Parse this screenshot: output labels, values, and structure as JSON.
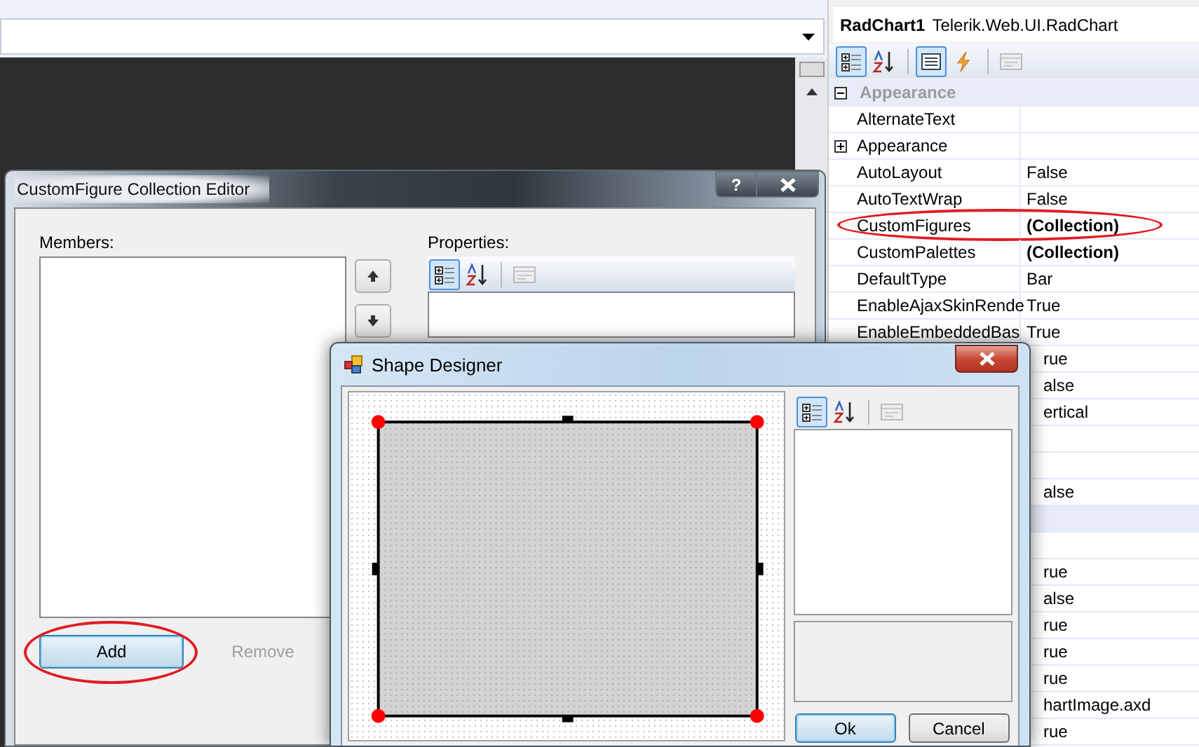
{
  "properties_panel": {
    "object_name": "RadChart1",
    "object_type": "Telerik.Web.UI.RadChart",
    "toolbar": [
      {
        "kind": "categorized",
        "selected": true,
        "disabled": false
      },
      {
        "kind": "alphabetical",
        "selected": false,
        "disabled": false
      },
      {
        "kind": "properties",
        "selected": true,
        "disabled": false
      },
      {
        "kind": "events",
        "selected": false,
        "disabled": false
      },
      {
        "kind": "pages",
        "selected": false,
        "disabled": true
      }
    ],
    "rows": [
      {
        "kind": "category",
        "name": "Appearance",
        "expanded": true
      },
      {
        "kind": "property",
        "name": "AlternateText"
      },
      {
        "kind": "property",
        "name": "Appearance",
        "expanded": false
      },
      {
        "kind": "property",
        "name": "AutoLayout",
        "value": "False"
      },
      {
        "kind": "property",
        "name": "AutoTextWrap",
        "value": "False"
      },
      {
        "kind": "property",
        "name": "CustomFigures",
        "value": "(Collection)",
        "bold": true,
        "circled": true
      },
      {
        "kind": "property",
        "name": "CustomPalettes",
        "value": "(Collection)",
        "bold": true
      },
      {
        "kind": "property",
        "name": "DefaultType",
        "value": "Bar"
      },
      {
        "kind": "property",
        "name": "EnableAjaxSkinRende",
        "value": "True"
      },
      {
        "kind": "property",
        "name": "EnableEmbeddedBas",
        "value": "True"
      },
      {
        "kind": "covered",
        "value": "rue"
      },
      {
        "kind": "covered",
        "value": "alse"
      },
      {
        "kind": "covered",
        "value": "ertical"
      },
      {
        "kind": "covered"
      },
      {
        "kind": "covered"
      },
      {
        "kind": "covered",
        "value": "alse"
      },
      {
        "kind": "covered_category"
      },
      {
        "kind": "covered"
      },
      {
        "kind": "covered",
        "value": "rue"
      },
      {
        "kind": "covered",
        "value": "alse"
      },
      {
        "kind": "covered",
        "value": "rue"
      },
      {
        "kind": "covered",
        "value": "rue"
      },
      {
        "kind": "covered",
        "value": "rue"
      },
      {
        "kind": "covered",
        "value": "hartImage.axd"
      },
      {
        "kind": "covered",
        "value": "rue"
      }
    ]
  },
  "collection_editor": {
    "title": "CustomFigure Collection Editor",
    "help_button": "?",
    "members_label": "Members:",
    "properties_label": "Properties:",
    "toolbar": [
      {
        "kind": "categorized",
        "selected": true,
        "disabled": false
      },
      {
        "kind": "alphabetical",
        "selected": false,
        "disabled": false
      },
      {
        "kind": "pages",
        "selected": false,
        "disabled": true
      }
    ],
    "add_button": {
      "label": "Add",
      "circled": true,
      "focused": true
    },
    "remove_button": {
      "label": "Remove",
      "disabled": true
    }
  },
  "shape_designer": {
    "title": "Shape Designer",
    "toolbar": [
      {
        "kind": "categorized",
        "selected": true,
        "disabled": false
      },
      {
        "kind": "alphabetical",
        "selected": false,
        "disabled": false
      },
      {
        "kind": "pages",
        "selected": false,
        "disabled": true
      }
    ],
    "ok_button": {
      "label": "Ok",
      "focused": true
    },
    "cancel_button": {
      "label": "Cancel",
      "focused": false
    }
  }
}
